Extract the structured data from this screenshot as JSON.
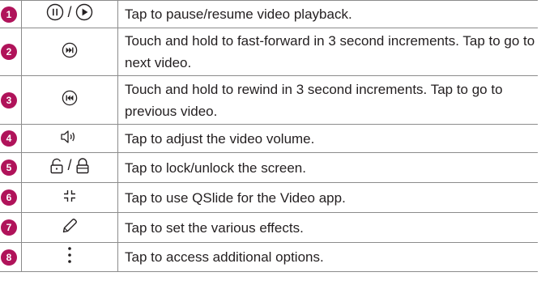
{
  "rows": [
    {
      "number": "1",
      "icons": [
        "pause-icon",
        "play-icon"
      ],
      "separator": "/",
      "description": "Tap to pause/resume video playback."
    },
    {
      "number": "2",
      "icons": [
        "fast-forward-icon"
      ],
      "separator": "",
      "description": "Touch and hold to fast-forward in 3 second increments. Tap to go to next video."
    },
    {
      "number": "3",
      "icons": [
        "rewind-icon"
      ],
      "separator": "",
      "description": "Touch and hold to rewind in 3 second increments. Tap to go to previous video."
    },
    {
      "number": "4",
      "icons": [
        "volume-icon"
      ],
      "separator": "",
      "description": "Tap to adjust the video volume."
    },
    {
      "number": "5",
      "icons": [
        "unlock-icon",
        "lock-icon"
      ],
      "separator": "/",
      "description": "Tap to lock/unlock the screen."
    },
    {
      "number": "6",
      "icons": [
        "qslide-icon"
      ],
      "separator": "",
      "description": "Tap to use QSlide for the Video app."
    },
    {
      "number": "7",
      "icons": [
        "pencil-icon"
      ],
      "separator": "",
      "description": "Tap to set the various effects."
    },
    {
      "number": "8",
      "icons": [
        "more-options-icon"
      ],
      "separator": "",
      "description": "Tap to access additional options."
    }
  ],
  "colors": {
    "badge": "#b0135a",
    "border": "#8c8c8c",
    "text": "#231f20"
  }
}
